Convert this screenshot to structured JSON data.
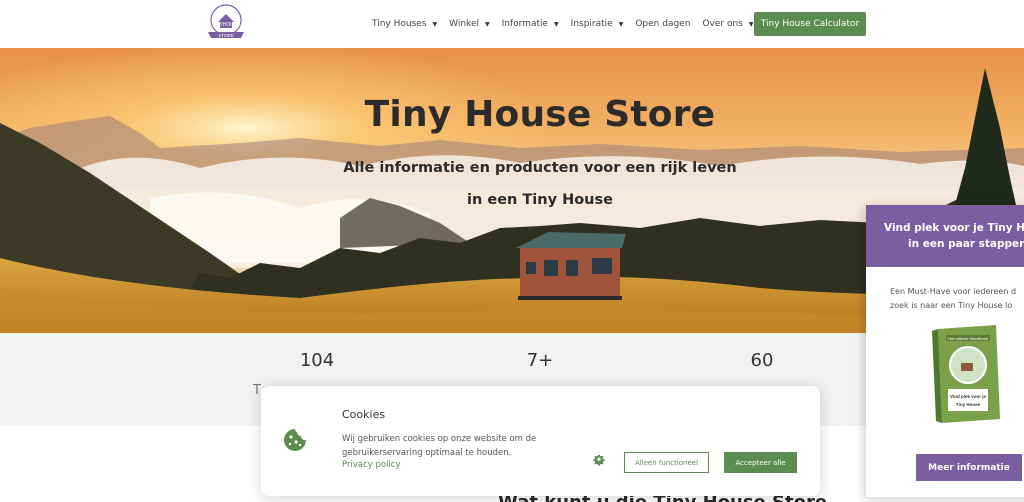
{
  "header": {
    "logo_alt": "Tiny House Store",
    "logo_text": "TINYHOUSE",
    "logo_ribbon": "STORE",
    "nav": [
      {
        "label": "Tiny Houses",
        "has_dropdown": true
      },
      {
        "label": "Winkel",
        "has_dropdown": true
      },
      {
        "label": "Informatie",
        "has_dropdown": true
      },
      {
        "label": "Inspiratie",
        "has_dropdown": true
      },
      {
        "label": "Open dagen",
        "has_dropdown": false
      },
      {
        "label": "Over ons",
        "has_dropdown": true
      }
    ],
    "cta_label": "Tiny House Calculator",
    "cta_color": "#5b8c50"
  },
  "hero": {
    "title": "Tiny House Store",
    "subtitle_line1": "Alle informatie en producten voor een rijk leven",
    "subtitle_line2": "in een Tiny House"
  },
  "stats": {
    "items": [
      {
        "value": "104"
      },
      {
        "value": "7+"
      },
      {
        "value": "60"
      }
    ],
    "label_fragment": "T"
  },
  "cookie": {
    "title": "Cookies",
    "text": "Wij gebruiken cookies op onze website om de gebruikerservaring optimaal te houden.",
    "privacy_link": "Privacy policy",
    "functional_label": "Alleen functioneel",
    "accept_label": "Accepteer alle",
    "accent_color": "#5b8c50"
  },
  "side_panel": {
    "title_line1": "Vind plek voor je Tiny H",
    "title_line2": "in een paar stappen",
    "text_line1": "Een Must-Have voor iedereen d",
    "text_line2": "zoek is naar een Tiny House lo",
    "book_title": "Het ultieme Handboek",
    "book_subtitle_line1": "Vind plek voor je",
    "book_subtitle_line2": "Tiny House",
    "button_label": "Meer informatie",
    "accent_color": "#7b5ea1"
  },
  "below": {
    "heading_fragment": "Wat kunt u die Tiny House Store"
  }
}
